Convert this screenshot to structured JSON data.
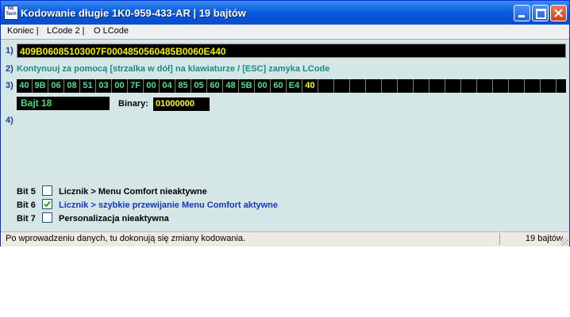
{
  "window": {
    "title": "Kodowanie długie   1K0-959-433-AR  |  19 bajtów",
    "icon_text": "NE Tech"
  },
  "menu": [
    "Koniec |",
    "LCode 2 |",
    "O LCode"
  ],
  "rows": {
    "row1_label": "1)",
    "row1_value": "409B06085103007F0004850560485B0060E440",
    "row2_label": "2)",
    "row2_text": "Kontynuuj za pomocą [strzalka w dół] na klawiaturze / [ESC] zamyka LCode",
    "row3_label": "3)",
    "row4_label": "4)"
  },
  "bytes": [
    "40",
    "9B",
    "06",
    "08",
    "51",
    "03",
    "00",
    "7F",
    "00",
    "04",
    "85",
    "05",
    "60",
    "48",
    "5B",
    "00",
    "60",
    "E4",
    "40",
    "",
    "",
    "",
    "",
    "",
    "",
    "",
    "",
    "",
    "",
    "",
    "",
    "",
    "",
    "",
    ""
  ],
  "selected_byte_index": 18,
  "byte_info": {
    "label": "Bajt 18",
    "binary_label": "Binary:",
    "binary_value": "01000000"
  },
  "bits": [
    {
      "label": "Bit 5",
      "checked": false,
      "text": "Licznik > Menu Comfort nieaktywne",
      "active": false
    },
    {
      "label": "Bit 6",
      "checked": true,
      "text": "Licznik > szybkie przewijanie Menu Comfort aktywne",
      "active": true
    },
    {
      "label": "Bit 7",
      "checked": false,
      "text": "Personalizacja nieaktywna",
      "active": false
    }
  ],
  "status": {
    "left": "Po wprowadzeniu danych, tu dokonują się zmiany kodowania.",
    "right": "19 bajtów"
  },
  "colors": {
    "background": "#d4e6e6",
    "hex_text": "#f0f000",
    "byte_text": "#49e08c",
    "active_text": "#1437c8"
  }
}
